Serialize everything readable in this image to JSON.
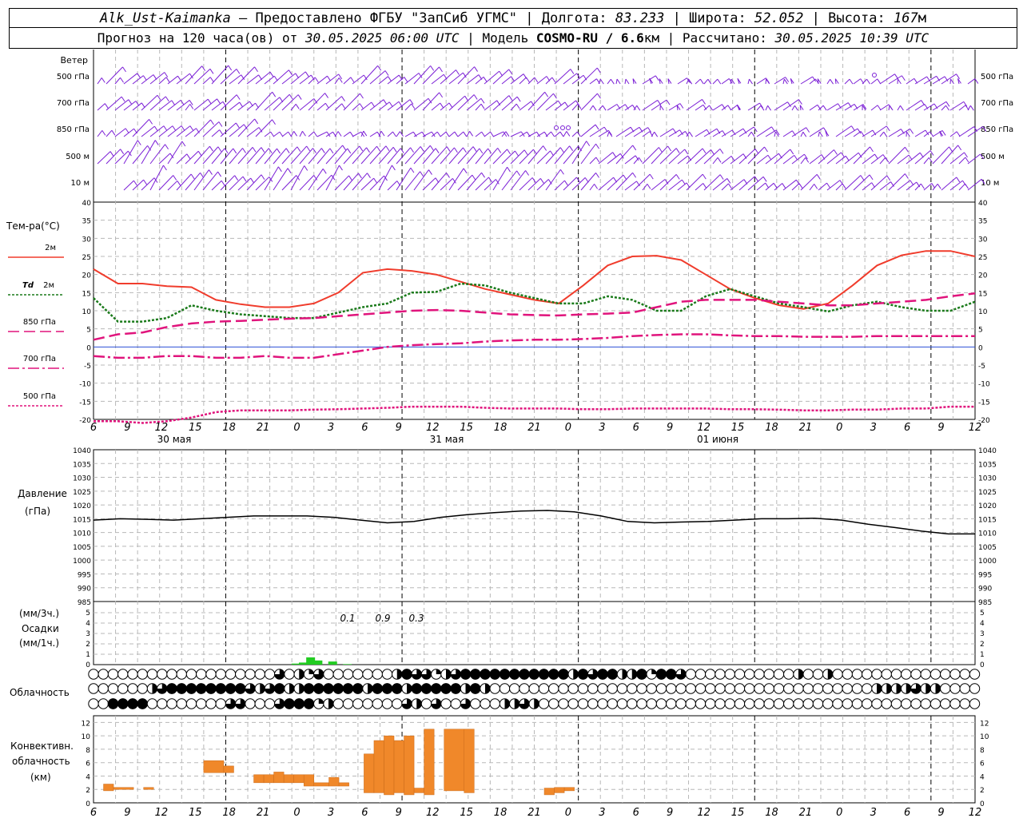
{
  "header": {
    "station": "Alk_Ust-Kaimanka",
    "provider_sep": "–",
    "provider": "Предоставлено ФГБУ \"ЗапСиб УГМС\"",
    "lon_label": "Долгота:",
    "lon": "83.233",
    "lat_label": "Широта:",
    "lat": "52.052",
    "alt_label": "Высота:",
    "alt": "167",
    "alt_unit": "м",
    "forecast_label": "Прогноз на 120 часа(ов) от",
    "forecast_start": "30.05.2025 06:00 UTC",
    "model_label": "Модель",
    "model": "COSMO-RU / 6.6",
    "model_unit": "км",
    "computed_label": "Рассчитано:",
    "computed": "30.05.2025 10:39 UTC"
  },
  "chart_data": [
    {
      "type": "wind-barbs",
      "panel_title": "Ветер",
      "levels": [
        "500 гПа",
        "700 гПа",
        "850 гПа",
        "500 м",
        "10 м"
      ],
      "barb_color": "#7b1fd6"
    },
    {
      "type": "line",
      "panel_title": "Тем-ра(°C)",
      "ylim": [
        -20,
        40
      ],
      "yticks": [
        40,
        35,
        30,
        25,
        20,
        15,
        10,
        5,
        0,
        -5,
        -10,
        -15,
        -20
      ],
      "x_hours": [
        0,
        3,
        6,
        9,
        12,
        15,
        18,
        21,
        24,
        27,
        30,
        33,
        36,
        39,
        42,
        45,
        48,
        51,
        54,
        57,
        60,
        63,
        66,
        69,
        72,
        75,
        78,
        81,
        84,
        87,
        90,
        93,
        96,
        99,
        102,
        105,
        108,
        111,
        114,
        117,
        120
      ],
      "series": [
        {
          "name": "2м",
          "color": "#f03c2c",
          "style": "solid",
          "values": [
            21.5,
            17.5,
            17.5,
            16.8,
            16.5,
            13,
            11.8,
            11,
            11,
            12,
            15,
            20.5,
            21.5,
            21,
            20,
            18,
            16,
            14.5,
            13,
            12,
            17,
            22.5,
            25,
            25.2,
            24,
            20,
            16,
            13.5,
            11.5,
            10.5,
            12,
            17,
            22.5,
            25.3,
            26.5,
            26.5,
            25
          ]
        },
        {
          "name": "Td 2м",
          "color": "#1a7a1a",
          "style": "dotted",
          "values": [
            13.5,
            7,
            7,
            8,
            11.5,
            10,
            9,
            8.5,
            8,
            8,
            9.5,
            11,
            12,
            15,
            15.2,
            17.5,
            17,
            15,
            13.5,
            12,
            12,
            14,
            13,
            10,
            10,
            14,
            16,
            14,
            12,
            11,
            9.8,
            11.5,
            12.5,
            11,
            10,
            10,
            12.5
          ]
        },
        {
          "name": "850 гПа",
          "color": "#e0147c",
          "style": "dash",
          "values": [
            2,
            3.5,
            4,
            5.5,
            6.5,
            7,
            7.2,
            7.5,
            7.8,
            8,
            8.5,
            9,
            9.5,
            10,
            10.2,
            10,
            9.5,
            9,
            8.8,
            8.7,
            9,
            9.2,
            9.5,
            11,
            12.5,
            13,
            13,
            13,
            12.5,
            12,
            11.5,
            11.5,
            12,
            12.5,
            13,
            14,
            14.8
          ]
        },
        {
          "name": "700 гПа",
          "color": "#e0147c",
          "style": "dashdot",
          "values": [
            -2.5,
            -3,
            -3,
            -2.5,
            -2.5,
            -3,
            -3,
            -2.5,
            -3,
            -3,
            -2,
            -1,
            0,
            0.5,
            0.8,
            1,
            1.5,
            1.8,
            2,
            2,
            2.2,
            2.5,
            3,
            3.3,
            3.5,
            3.5,
            3.2,
            3,
            3,
            2.8,
            2.8,
            2.8,
            3,
            3,
            3,
            3,
            3
          ]
        },
        {
          "name": "500 гПа",
          "color": "#e0147c",
          "style": "dotted",
          "values": [
            -20.5,
            -20.5,
            -21,
            -20.5,
            -19.5,
            -18,
            -17.5,
            -17.5,
            -17.5,
            -17.3,
            -17.2,
            -17,
            -16.8,
            -16.5,
            -16.5,
            -16.5,
            -16.8,
            -17,
            -17,
            -17,
            -17.2,
            -17.2,
            -17,
            -17,
            -17,
            -17,
            -17.2,
            -17.2,
            -17.3,
            -17.5,
            -17.5,
            -17.3,
            -17.3,
            -17,
            -17,
            -16.5,
            -16.5
          ]
        }
      ]
    },
    {
      "type": "line",
      "panel_title": "Давление",
      "panel_unit": "(гПа)",
      "ylim": [
        985,
        1040
      ],
      "yticks": [
        1040,
        1035,
        1030,
        1025,
        1020,
        1015,
        1010,
        1005,
        1000,
        995,
        990,
        985
      ],
      "series": [
        {
          "name": "Давление",
          "color": "#000000",
          "values": [
            1014.5,
            1015,
            1014.8,
            1014.5,
            1015,
            1015.5,
            1016,
            1016,
            1016,
            1015.5,
            1014.5,
            1013.5,
            1014,
            1015.5,
            1016.5,
            1017.2,
            1017.8,
            1018,
            1017.5,
            1016,
            1014,
            1013.5,
            1013.8,
            1014,
            1014.5,
            1015,
            1015,
            1015.2,
            1014.5,
            1013,
            1011.8,
            1010.5,
            1009.5,
            1009.5
          ]
        }
      ]
    },
    {
      "type": "bar",
      "panel_title": "Осадки",
      "units_top": "(мм/3ч.)",
      "units_bottom": "(мм/1ч.)",
      "ylim": [
        0,
        5
      ],
      "yticks": [
        5,
        4,
        3,
        2,
        1,
        0
      ],
      "totals_3h": [
        "0.1",
        "0.9",
        "0.3"
      ],
      "bar_color": "#22cc22",
      "bars_1h": [
        {
          "x_hour": 27.5,
          "value": 0.1
        },
        {
          "x_hour": 28.5,
          "value": 0.2
        },
        {
          "x_hour": 29.5,
          "value": 0.7
        },
        {
          "x_hour": 30.5,
          "value": 0.4
        },
        {
          "x_hour": 32.5,
          "value": 0.3
        },
        {
          "x_hour": 34.5,
          "value": 0.05
        }
      ]
    },
    {
      "type": "table",
      "panel_title": "Облачность",
      "rows": 3,
      "cover_fraction_rows": [
        [
          0,
          0,
          0,
          0,
          0,
          0,
          0,
          0,
          0,
          0,
          0,
          0,
          0,
          0,
          0,
          0,
          0,
          0,
          0,
          0.75,
          0,
          0.5,
          0.25,
          0.75,
          0,
          0,
          0,
          0,
          0,
          0,
          0,
          0.5,
          1,
          0.75,
          0.75,
          0.25,
          0.5,
          0.75,
          1,
          1,
          1,
          1,
          1,
          1,
          1,
          1,
          1,
          1,
          1,
          0.5,
          1,
          0.75,
          1,
          1,
          0.5,
          0.5,
          1,
          0.25,
          1,
          1,
          0.75,
          0,
          0,
          0,
          0,
          0,
          0,
          0,
          0,
          0,
          0,
          0,
          0.5,
          0,
          0,
          0.5,
          0,
          0,
          0,
          0,
          0,
          0,
          0,
          0,
          0,
          0,
          0,
          0,
          0,
          0,
          0,
          0,
          0,
          0,
          0,
          0,
          0,
          0,
          0,
          0,
          0,
          0,
          0,
          0,
          0,
          0,
          0,
          0,
          0,
          0,
          0,
          0,
          0,
          0,
          0,
          0,
          0,
          0,
          0,
          0,
          1,
          0.75,
          1
        ],
        [
          0,
          0,
          0,
          0,
          0,
          0,
          0.5,
          0.75,
          1,
          1,
          1,
          1,
          1,
          1,
          1,
          1,
          0.75,
          0.5,
          0.75,
          1,
          0.5,
          0.5,
          1,
          1,
          1,
          1,
          1,
          1,
          0.5,
          1,
          1,
          1,
          0.5,
          1,
          1,
          1,
          1,
          1,
          0.5,
          1,
          0.5,
          0,
          0,
          0,
          0,
          0,
          0,
          0,
          0,
          0,
          0,
          0,
          0,
          0,
          0,
          0,
          0,
          0,
          0,
          0,
          0,
          0,
          0,
          0,
          0,
          0,
          0,
          0,
          0,
          0,
          0,
          0,
          0,
          0,
          0,
          0,
          0,
          0,
          0,
          0,
          0.5,
          0.5,
          0.5,
          0.5,
          0.75,
          0.5,
          0.5,
          0,
          0,
          0,
          0,
          0,
          0,
          0,
          0,
          0,
          0,
          0,
          0,
          0,
          0,
          0,
          0,
          0,
          0,
          0,
          0,
          0,
          0,
          0,
          0,
          0,
          0,
          0,
          0,
          0,
          0,
          0,
          0,
          0,
          0,
          0,
          0,
          0,
          0,
          0,
          0,
          0,
          0.75
        ],
        [
          0,
          0,
          1,
          1,
          1,
          1,
          0,
          0,
          0,
          0,
          0,
          0,
          0,
          0,
          0.75,
          0.75,
          0,
          0,
          0,
          0.75,
          1,
          1,
          1,
          0.25,
          0.5,
          0,
          0,
          0,
          0,
          0,
          0,
          0,
          0.75,
          0.5,
          0,
          0.75,
          0,
          0,
          0.75,
          0,
          0,
          0,
          0.5,
          0.5,
          0.75,
          0.5,
          0,
          0,
          0,
          0,
          0,
          0,
          0,
          0,
          0,
          0,
          0,
          0,
          0,
          0,
          0,
          0,
          0,
          0,
          0,
          0,
          0,
          0,
          0,
          0,
          0,
          0,
          0,
          0,
          0,
          0,
          0,
          0,
          0,
          0,
          0,
          0,
          0,
          0,
          0,
          0,
          0,
          0,
          0,
          0,
          0,
          0,
          0,
          0,
          0,
          0,
          0,
          0,
          0,
          0,
          0,
          0,
          0,
          0,
          0,
          0,
          0,
          0,
          0,
          0,
          0,
          0,
          0,
          0,
          0,
          0,
          0,
          0,
          0,
          0,
          0,
          0,
          0,
          0,
          0,
          0
        ]
      ]
    },
    {
      "type": "bar",
      "panel_title_1": "Конвективн.",
      "panel_title_2": "облачность",
      "panel_unit": "(км)",
      "ylim": [
        0,
        13
      ],
      "yticks": [
        12,
        10,
        8,
        6,
        4,
        2,
        0
      ],
      "bar_color": "#f0882a",
      "bars": [
        {
          "x0": 1,
          "x1": 2,
          "base": 1.8,
          "top": 2.8
        },
        {
          "x0": 2,
          "x1": 4,
          "base": 2.0,
          "top": 2.3
        },
        {
          "x0": 5,
          "x1": 6,
          "base": 2.0,
          "top": 2.3
        },
        {
          "x0": 11,
          "x1": 13,
          "base": 4.5,
          "top": 6.3
        },
        {
          "x0": 13,
          "x1": 14,
          "base": 4.5,
          "top": 5.5
        },
        {
          "x0": 16,
          "x1": 17,
          "base": 3.0,
          "top": 4.2
        },
        {
          "x0": 17,
          "x1": 18,
          "base": 3.0,
          "top": 4.2
        },
        {
          "x0": 18,
          "x1": 19,
          "base": 3.0,
          "top": 4.6
        },
        {
          "x0": 19,
          "x1": 20,
          "base": 3.0,
          "top": 4.2
        },
        {
          "x0": 20,
          "x1": 21,
          "base": 3.0,
          "top": 4.2
        },
        {
          "x0": 21,
          "x1": 22,
          "base": 2.5,
          "top": 4.2
        },
        {
          "x0": 22,
          "x1": 23.5,
          "base": 2.5,
          "top": 3.0
        },
        {
          "x0": 23.5,
          "x1": 24.5,
          "base": 2.5,
          "top": 3.8
        },
        {
          "x0": 24.5,
          "x1": 25.5,
          "base": 2.5,
          "top": 3.0
        },
        {
          "x0": 27,
          "x1": 28,
          "base": 1.5,
          "top": 7.3
        },
        {
          "x0": 28,
          "x1": 29,
          "base": 1.5,
          "top": 9.3
        },
        {
          "x0": 29,
          "x1": 30,
          "base": 1.2,
          "top": 10.0
        },
        {
          "x0": 30,
          "x1": 31,
          "base": 1.5,
          "top": 9.3
        },
        {
          "x0": 31,
          "x1": 32,
          "base": 1.2,
          "top": 10.0
        },
        {
          "x0": 32,
          "x1": 33,
          "base": 1.5,
          "top": 2.2
        },
        {
          "x0": 33,
          "x1": 34,
          "base": 1.2,
          "top": 11.0
        },
        {
          "x0": 35,
          "x1": 37,
          "base": 1.8,
          "top": 11.0
        },
        {
          "x0": 37,
          "x1": 38,
          "base": 1.5,
          "top": 11.0
        },
        {
          "x0": 45,
          "x1": 46,
          "base": 1.2,
          "top": 2.2
        },
        {
          "x0": 46,
          "x1": 47,
          "base": 1.5,
          "top": 2.3
        },
        {
          "x0": 47,
          "x1": 48,
          "base": 1.8,
          "top": 2.3
        }
      ]
    }
  ],
  "x_axis": {
    "hour_labels": [
      "6",
      "9",
      "12",
      "15",
      "18",
      "21",
      "0",
      "3",
      "6",
      "9",
      "12",
      "15",
      "18",
      "21",
      "0",
      "3",
      "6",
      "9",
      "12",
      "15",
      "18",
      "21",
      "0",
      "3",
      "6",
      "9",
      "12"
    ],
    "date_labels": [
      "30 мая",
      "31 мая",
      "01 июня"
    ]
  },
  "legend": {
    "t2m": "2м",
    "td_prefix": "Td",
    "td_suffix": "2м",
    "t850": "850 гПа",
    "t700": "700 гПа",
    "t500": "500 гПа"
  }
}
